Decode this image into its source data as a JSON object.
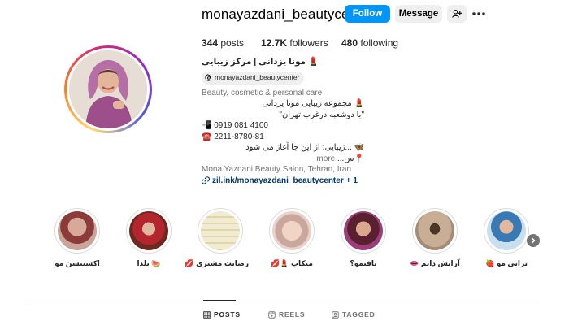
{
  "profile": {
    "username": "monayazdani_beautycenter",
    "follow_label": "Follow",
    "message_label": "Message",
    "stats": {
      "posts_count": "344",
      "posts_label": "posts",
      "followers_count": "12.7K",
      "followers_label": "followers",
      "following_count": "480",
      "following_label": "following"
    },
    "full_name": "💄 مونا یزدانی | مرکز زیبایی",
    "threads_handle": "monayazdani_beautycenter",
    "category": "Beauty, cosmetic & personal care",
    "bio_lines": [
      "💄 مجموعه زیبایی مونا یزدانی",
      "\"با دوشعبه درغرب تهران\"",
      "📲 0919 081 4100",
      "☎️ 2211-8780-81",
      "🦋 ...زیبایی؛ از این جا آغاز می شود",
      "📍س..."
    ],
    "more_label": "more",
    "location": "Mona Yazdani Beauty Salon, Tehran, Iran",
    "link": "zil.ink/monayazdani_beautycenter",
    "link_extra": "+ 1"
  },
  "highlights": [
    {
      "label": "اکستنشن مو",
      "color": "#c9a59a"
    },
    {
      "label": "🍉 یلدا",
      "color": "#8a3b2e"
    },
    {
      "label": "رضایت مشتری 💋",
      "color": "#e6e0c8"
    },
    {
      "label": "میکاپ 💄💋",
      "color": "#e8d2c9"
    },
    {
      "label": "بافتمو؟",
      "color": "#7a3d5a"
    },
    {
      "label": "آرایش دایم 👄",
      "color": "#b39a84"
    },
    {
      "label": "ترابی مو 🍓",
      "color": "#8fb6d4"
    }
  ],
  "tabs": {
    "posts": "POSTS",
    "reels": "REELS",
    "tagged": "TAGGED"
  },
  "colors": {
    "accent": "#0095f6",
    "link": "#00376b",
    "secondary_text": "#737373"
  }
}
